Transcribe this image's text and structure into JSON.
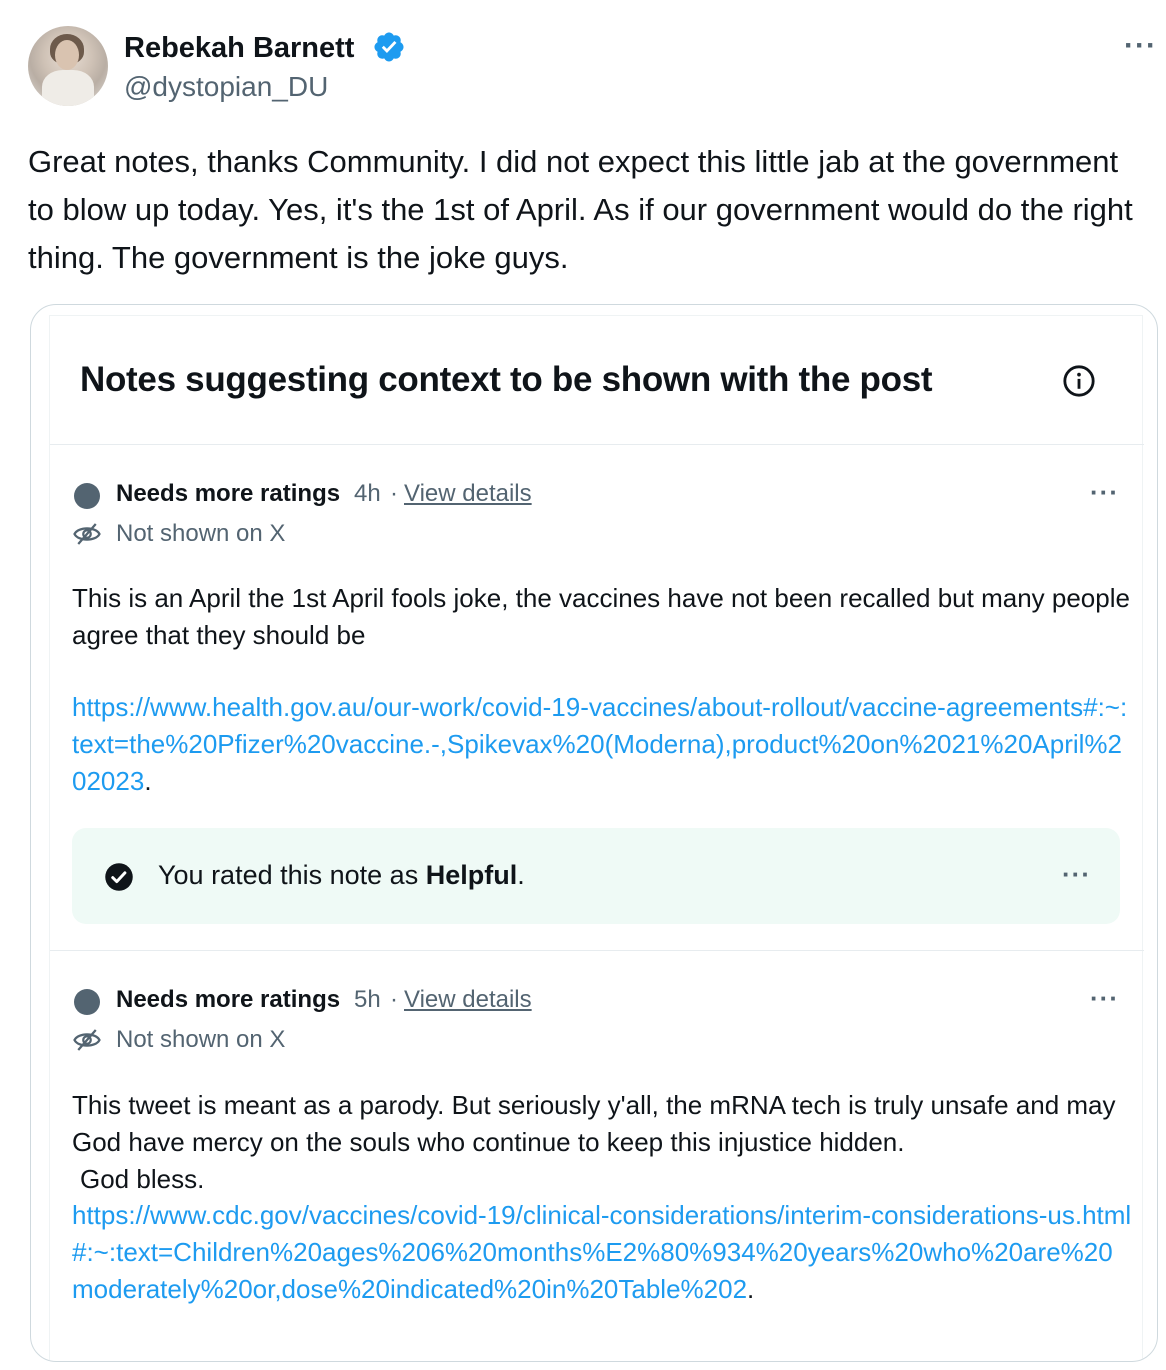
{
  "author": {
    "name": "Rebekah Barnett",
    "handle": "@dystopian_DU"
  },
  "post": {
    "text": "Great notes, thanks Community. I did not expect this little jab at the government to blow up today. Yes, it's the 1st of April. As if our government would do the right thing. The government is the joke guys."
  },
  "more_label": "···",
  "notes_panel": {
    "title": "Notes suggesting context to be shown with the post",
    "notes": [
      {
        "status": "Needs more ratings",
        "time": "4h",
        "separator": "·",
        "view_details": "View details",
        "not_shown": "Not shown on X",
        "text": "This is an April the 1st April fools joke, the vaccines have not been recalled but many people agree that they should be",
        "link": "https://www.health.gov.au/our-work/covid-19-vaccines/about-rollout/vaccine-agreements#:~:text=the%20Pfizer%20vaccine.-,Spikevax%20(Moderna),product%20on%2021%20April%202023",
        "link_suffix": ".",
        "rating": {
          "prefix": "You rated this note as ",
          "value": "Helpful",
          "suffix": "."
        }
      },
      {
        "status": "Needs more ratings",
        "time": "5h",
        "separator": "·",
        "view_details": "View details",
        "not_shown": "Not shown on X",
        "text_line1": "This tweet is meant as a parody.  But seriously y'all, the mRNA tech is truly unsafe and may God have mercy on the souls who continue to keep this injustice hidden.",
        "text_line2": "God bless.",
        "link": "https://www.cdc.gov/vaccines/covid-19/clinical-considerations/interim-considerations-us.html#:~:text=Children%20ages%206%20months%E2%80%934%20years%20who%20are%20moderately%20or,dose%20indicated%20in%20Table%202",
        "link_suffix": "."
      }
    ]
  },
  "colors": {
    "text": "#0f1419",
    "secondary": "#536471",
    "link": "#1d9bf0",
    "verified": "#1d9bf0",
    "rated_bg": "#effaf6"
  }
}
